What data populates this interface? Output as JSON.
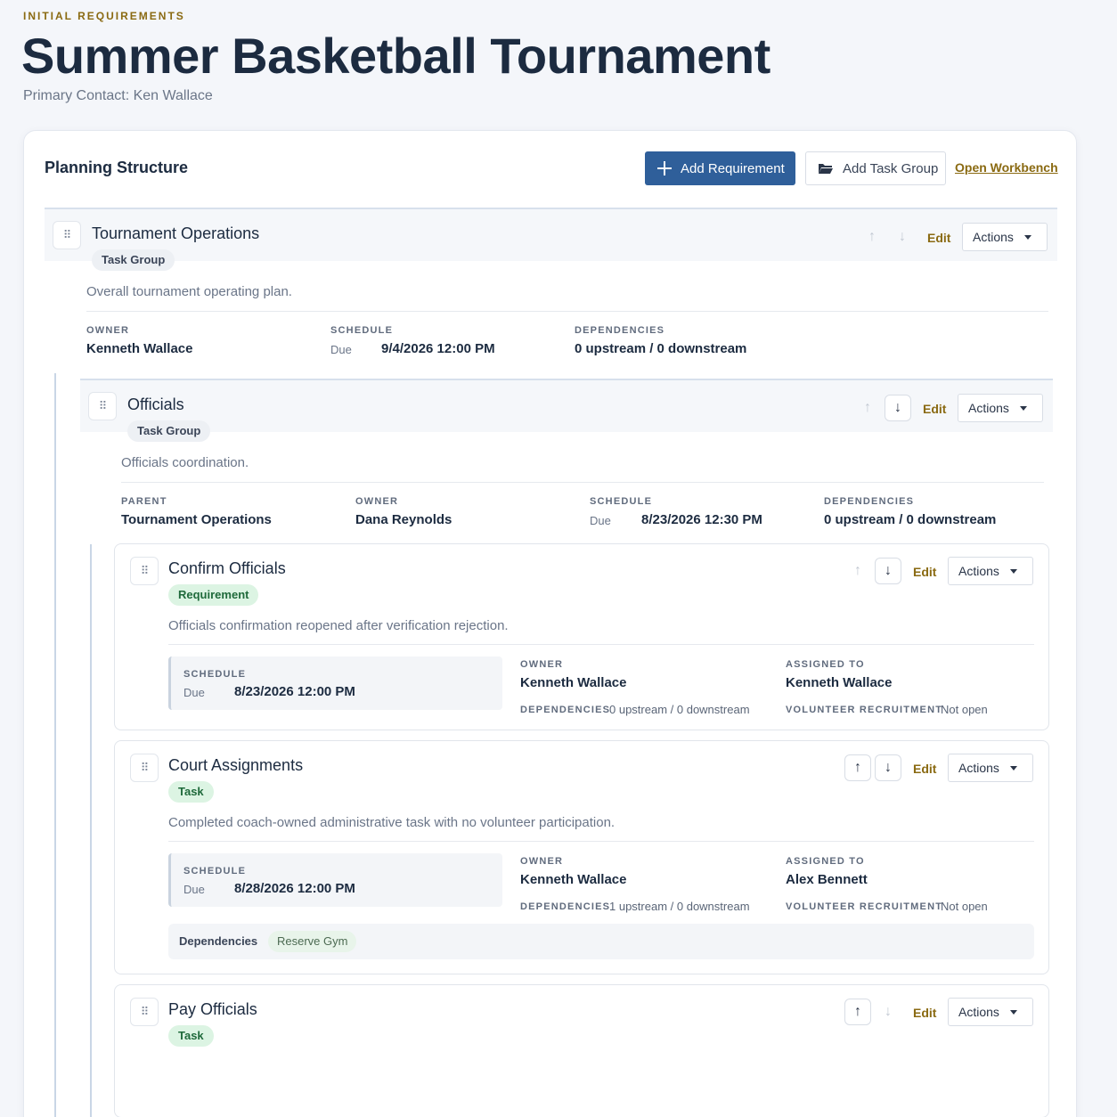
{
  "header": {
    "eyebrow": "INITIAL REQUIREMENTS",
    "title": "Summer Basketball Tournament",
    "primary_contact": "Primary Contact: Ken Wallace"
  },
  "panel": {
    "title": "Planning Structure",
    "add_requirement": "Add Requirement",
    "add_task_group": "Add Task Group",
    "open_workbench": "Open Workbench"
  },
  "controls": {
    "edit": "Edit",
    "actions": "Actions",
    "up_arrow": "↑",
    "down_arrow": "↓",
    "drag_glyph": "⠿"
  },
  "labels": {
    "owner": "OWNER",
    "schedule": "SCHEDULE",
    "dependencies": "DEPENDENCIES",
    "parent": "PARENT",
    "assigned_to": "ASSIGNED TO",
    "volunteer_recruitment": "VOLUNTEER RECRUITMENT",
    "due": "Due",
    "dependencies_row": "Dependencies"
  },
  "items": [
    {
      "title": "Tournament Operations",
      "tag": "Task Group",
      "description": "Overall tournament operating plan.",
      "owner": "Kenneth Wallace",
      "due": "9/4/2026 12:00 PM",
      "dependencies": "0 upstream / 0 downstream"
    },
    {
      "title": "Officials",
      "tag": "Task Group",
      "description": "Officials coordination.",
      "parent": "Tournament Operations",
      "owner": "Dana Reynolds",
      "due": "8/23/2026 12:30 PM",
      "dependencies": "0 upstream / 0 downstream"
    },
    {
      "title": "Confirm Officials",
      "tag": "Requirement",
      "description": "Officials confirmation reopened after verification rejection.",
      "due": "8/23/2026 12:00 PM",
      "owner": "Kenneth Wallace",
      "dependencies": "0 upstream / 0 downstream",
      "assigned_to": "Kenneth Wallace",
      "volunteer_recruitment": "Not open"
    },
    {
      "title": "Court Assignments",
      "tag": "Task",
      "description": "Completed coach-owned administrative task with no volunteer participation.",
      "due": "8/28/2026 12:00 PM",
      "owner": "Kenneth Wallace",
      "dependencies": "1 upstream / 0 downstream",
      "assigned_to": "Alex Bennett",
      "volunteer_recruitment": "Not open",
      "dependency_chips": [
        "Reserve Gym"
      ]
    },
    {
      "title": "Pay Officials",
      "tag": "Task"
    }
  ]
}
